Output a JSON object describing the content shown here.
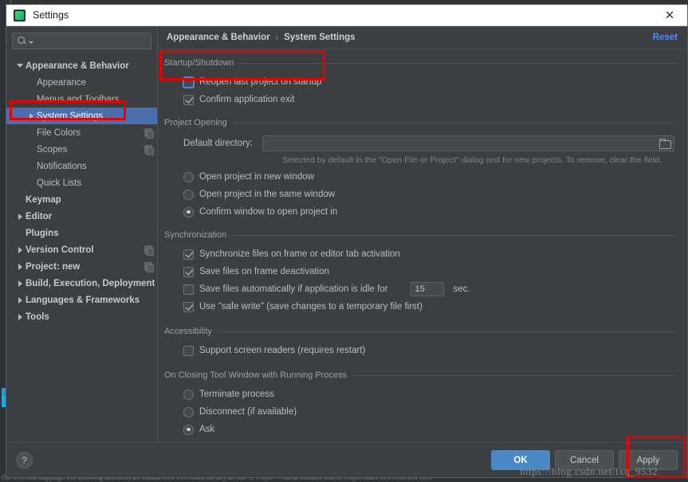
{
  "window": {
    "title": "Settings",
    "app_icon": "android-studio-icon",
    "close_icon": "close-icon"
  },
  "sidebar": {
    "search": {
      "icon": "search-icon",
      "dropdown_icon": "chevron-down-icon",
      "value": "",
      "placeholder": ""
    },
    "items": [
      {
        "label": "Appearance & Behavior",
        "indent": 0,
        "arrow": "expanded",
        "bold": true,
        "selected": false,
        "badge": false
      },
      {
        "label": "Appearance",
        "indent": 1,
        "arrow": "none",
        "bold": false,
        "selected": false,
        "badge": false
      },
      {
        "label": "Menus and Toolbars",
        "indent": 1,
        "arrow": "none",
        "bold": false,
        "selected": false,
        "badge": false
      },
      {
        "label": "System Settings",
        "indent": 1,
        "arrow": "collapsed",
        "bold": false,
        "selected": true,
        "badge": false
      },
      {
        "label": "File Colors",
        "indent": 1,
        "arrow": "none",
        "bold": false,
        "selected": false,
        "badge": true
      },
      {
        "label": "Scopes",
        "indent": 1,
        "arrow": "none",
        "bold": false,
        "selected": false,
        "badge": true
      },
      {
        "label": "Notifications",
        "indent": 1,
        "arrow": "none",
        "bold": false,
        "selected": false,
        "badge": false
      },
      {
        "label": "Quick Lists",
        "indent": 1,
        "arrow": "none",
        "bold": false,
        "selected": false,
        "badge": false
      },
      {
        "label": "Keymap",
        "indent": 0,
        "arrow": "none",
        "bold": true,
        "selected": false,
        "badge": false
      },
      {
        "label": "Editor",
        "indent": 0,
        "arrow": "collapsed",
        "bold": true,
        "selected": false,
        "badge": false
      },
      {
        "label": "Plugins",
        "indent": 0,
        "arrow": "none",
        "bold": true,
        "selected": false,
        "badge": false
      },
      {
        "label": "Version Control",
        "indent": 0,
        "arrow": "collapsed",
        "bold": true,
        "selected": false,
        "badge": true
      },
      {
        "label": "Project: new",
        "indent": 0,
        "arrow": "collapsed",
        "bold": true,
        "selected": false,
        "badge": true
      },
      {
        "label": "Build, Execution, Deployment",
        "indent": 0,
        "arrow": "collapsed",
        "bold": true,
        "selected": false,
        "badge": false
      },
      {
        "label": "Languages & Frameworks",
        "indent": 0,
        "arrow": "collapsed",
        "bold": true,
        "selected": false,
        "badge": false
      },
      {
        "label": "Tools",
        "indent": 0,
        "arrow": "collapsed",
        "bold": true,
        "selected": false,
        "badge": false
      }
    ]
  },
  "breadcrumb": {
    "parent": "Appearance & Behavior",
    "separator": "›",
    "current": "System Settings",
    "reset_label": "Reset"
  },
  "sections": {
    "startup": {
      "title": "Startup/Shutdown",
      "reopen_last_project": {
        "label": "Reopen last project on startup",
        "checked": false
      },
      "confirm_application_exit": {
        "label": "Confirm application exit",
        "checked": true
      }
    },
    "project_opening": {
      "title": "Project Opening",
      "default_directory_label": "Default directory:",
      "default_directory_value": "",
      "browse_icon": "folder-icon",
      "hint": "Selected by default in the \"Open File or Project\" dialog and for new projects. To remove, clear the field.",
      "options": [
        {
          "label": "Open project in new window",
          "selected": false
        },
        {
          "label": "Open project in the same window",
          "selected": false
        },
        {
          "label": "Confirm window to open project in",
          "selected": true
        }
      ]
    },
    "synchronization": {
      "title": "Synchronization",
      "sync_on_activation": {
        "label": "Synchronize files on frame or editor tab activation",
        "checked": true
      },
      "save_on_deactivation": {
        "label": "Save files on frame deactivation",
        "checked": true
      },
      "auto_save_idle": {
        "label": "Save files automatically if application is idle for",
        "checked": false,
        "value": "15",
        "unit": "sec."
      },
      "safe_write": {
        "label": "Use \"safe write\" (save changes to a temporary file first)",
        "checked": true
      }
    },
    "accessibility": {
      "title": "Accessibility",
      "screen_readers": {
        "label": "Support screen readers (requires restart)",
        "checked": false
      }
    },
    "closing_tool_window": {
      "title": "On Closing Tool Window with Running Process",
      "options": [
        {
          "label": "Terminate process",
          "selected": false
        },
        {
          "label": "Disconnect (if available)",
          "selected": false
        },
        {
          "label": "Ask",
          "selected": true
        }
      ]
    }
  },
  "footer": {
    "help_label": "?",
    "ok_label": "OK",
    "cancel_label": "Cancel",
    "apply_label": "Apply"
  },
  "annotations": {
    "watermark": "https://blog.csdn.net/lxq_9532",
    "highlight_color": "#e60000",
    "boxes": [
      "startup-shutdown-highlight",
      "system-settings-highlight",
      "apply-button-highlight"
    ]
  },
  "backdrop": {
    "bottom_text": "Old VCS root mappings. The following directories are considered a VCS roots, but they are not. U. Project > Not all installed with U. Project index 11.0%          Git           new  Devi"
  }
}
